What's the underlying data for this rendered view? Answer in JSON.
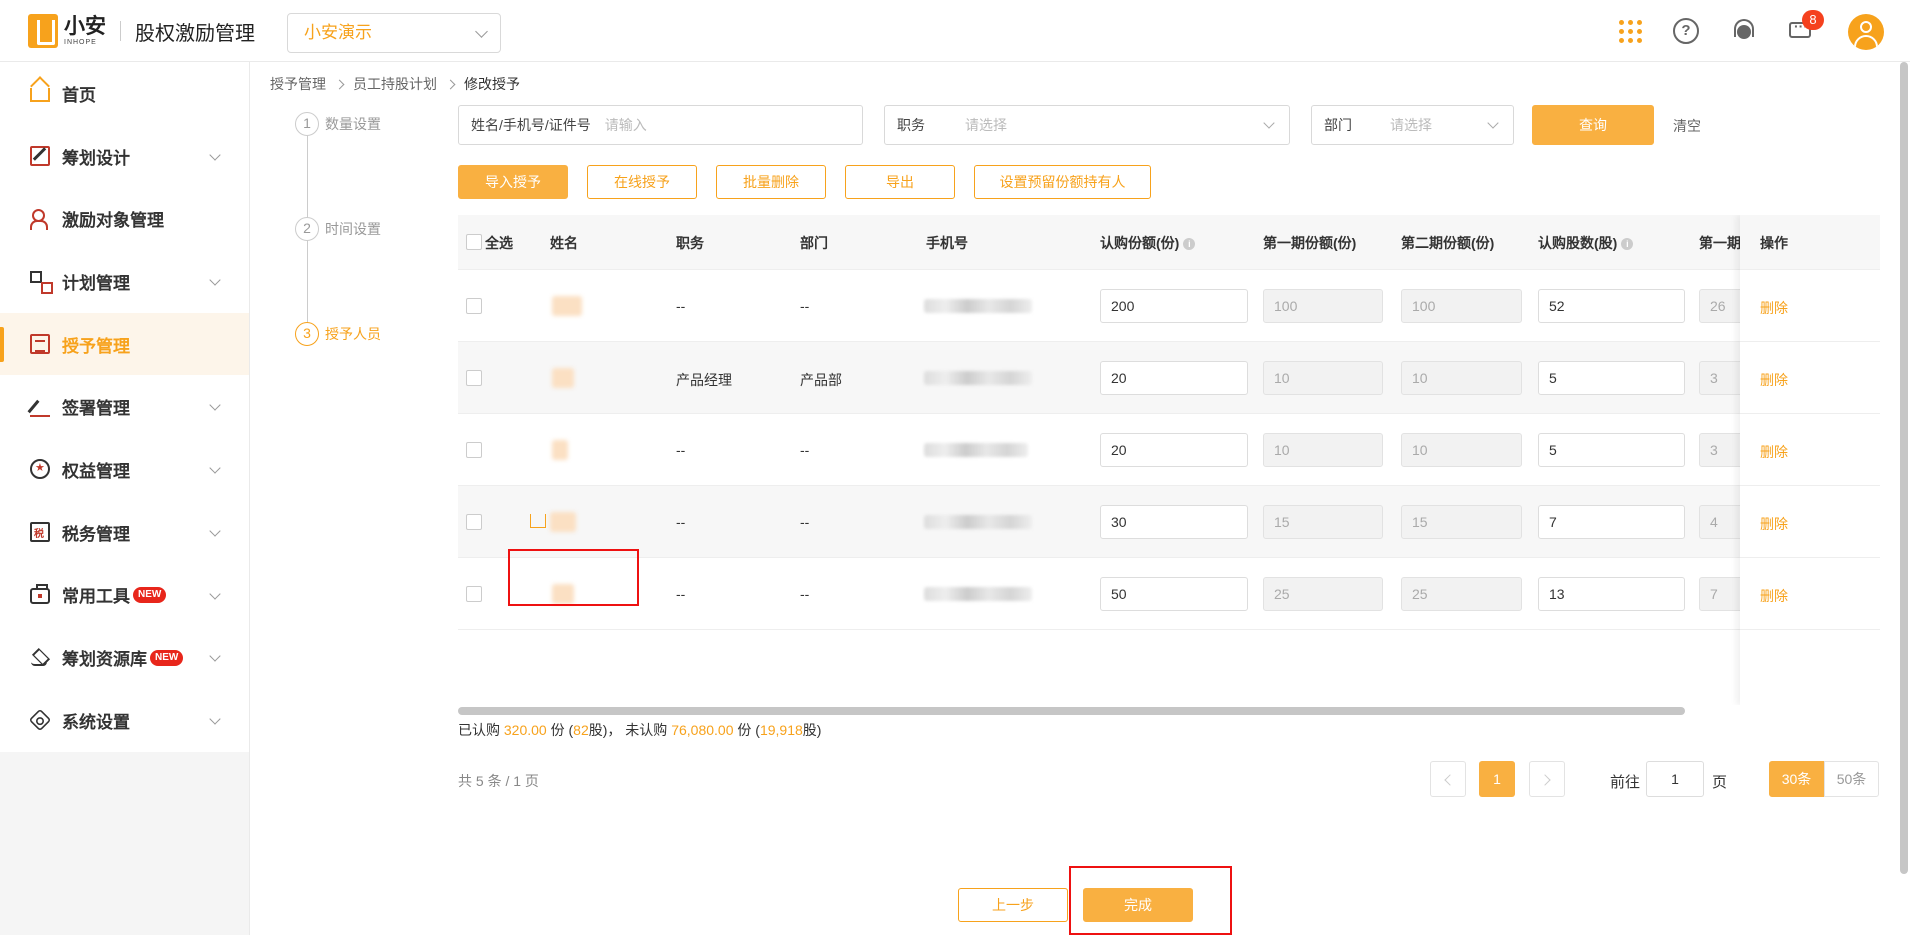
{
  "header": {
    "logo_cn": "小安",
    "logo_en": "INHOPE",
    "app_title": "股权激励管理",
    "company": "小安演示",
    "notification_count": "8"
  },
  "sidebar": {
    "items": [
      {
        "label": "首页",
        "icon": "home-icon",
        "active": false,
        "expandable": false
      },
      {
        "label": "筹划设计",
        "icon": "edit-icon",
        "active": false,
        "expandable": true
      },
      {
        "label": "激励对象管理",
        "icon": "people-icon",
        "active": false,
        "expandable": false
      },
      {
        "label": "计划管理",
        "icon": "plan-icon",
        "active": false,
        "expandable": true
      },
      {
        "label": "授予管理",
        "icon": "grant-icon",
        "active": true,
        "expandable": false
      },
      {
        "label": "签署管理",
        "icon": "sign-icon",
        "active": false,
        "expandable": true
      },
      {
        "label": "权益管理",
        "icon": "equity-icon",
        "active": false,
        "expandable": true
      },
      {
        "label": "税务管理",
        "icon": "tax-icon",
        "active": false,
        "expandable": true
      },
      {
        "label": "常用工具",
        "icon": "toolbox-icon",
        "active": false,
        "expandable": true,
        "tag": "NEW"
      },
      {
        "label": "筹划资源库",
        "icon": "layers-icon",
        "active": false,
        "expandable": true,
        "tag": "NEW"
      },
      {
        "label": "系统设置",
        "icon": "settings-icon",
        "active": false,
        "expandable": true
      }
    ]
  },
  "breadcrumb": [
    "授予管理",
    "员工持股计划",
    "修改授予"
  ],
  "steps": [
    {
      "num": "1",
      "label": "数量设置"
    },
    {
      "num": "2",
      "label": "时间设置"
    },
    {
      "num": "3",
      "label": "授予人员"
    }
  ],
  "filters": {
    "name_label": "姓名/手机号/证件号",
    "name_placeholder": "请输入",
    "position_label": "职务",
    "position_placeholder": "请选择",
    "dept_label": "部门",
    "dept_placeholder": "请选择",
    "query": "查询",
    "clear": "清空"
  },
  "actions": {
    "import": "导入授予",
    "online": "在线授予",
    "batch_delete": "批量删除",
    "export": "导出",
    "set_reserved": "设置预留份额持有人"
  },
  "table": {
    "headers": {
      "select_all": "全选",
      "name": "姓名",
      "position": "职务",
      "dept": "部门",
      "phone": "手机号",
      "subscribed_units": "认购份额(份)",
      "first_units": "第一期份额(份)",
      "second_units": "第二期份额(份)",
      "subscribed_shares": "认购股数(股)",
      "first_shares_partial": "第一期",
      "operation": "操作"
    },
    "rows": [
      {
        "position": "--",
        "dept": "--",
        "units": "200",
        "first": "100",
        "second": "100",
        "shares": "52",
        "first_shares": "26",
        "op": "删除"
      },
      {
        "position": "产品经理",
        "dept": "产品部",
        "units": "20",
        "first": "10",
        "second": "10",
        "shares": "5",
        "first_shares": "3",
        "op": "删除"
      },
      {
        "position": "--",
        "dept": "--",
        "units": "20",
        "first": "10",
        "second": "10",
        "shares": "5",
        "first_shares": "3",
        "op": "删除"
      },
      {
        "position": "--",
        "dept": "--",
        "units": "30",
        "first": "15",
        "second": "15",
        "shares": "7",
        "first_shares": "4",
        "op": "删除"
      },
      {
        "position": "--",
        "dept": "--",
        "units": "50",
        "first": "25",
        "second": "25",
        "shares": "13",
        "first_shares": "7",
        "op": "删除"
      }
    ]
  },
  "summary": {
    "t1": "已认购",
    "subscribed_units": "320.00",
    "t2": "份 (",
    "subscribed_shares": "82",
    "t3": "股)， 未认购",
    "unsubscribed_units": "76,080.00",
    "t4": "份 (",
    "unsubscribed_shares": "19,918",
    "t5": "股)"
  },
  "pagination": {
    "total": "共 5 条 / 1 页",
    "current": "1",
    "goto_label": "前往",
    "goto_value": "1",
    "page_unit": "页",
    "size_30": "30条",
    "size_50": "50条"
  },
  "footer": {
    "prev": "上一步",
    "finish": "完成"
  },
  "colors": {
    "accent": "#f7a21c",
    "highlight": "#e11111"
  }
}
